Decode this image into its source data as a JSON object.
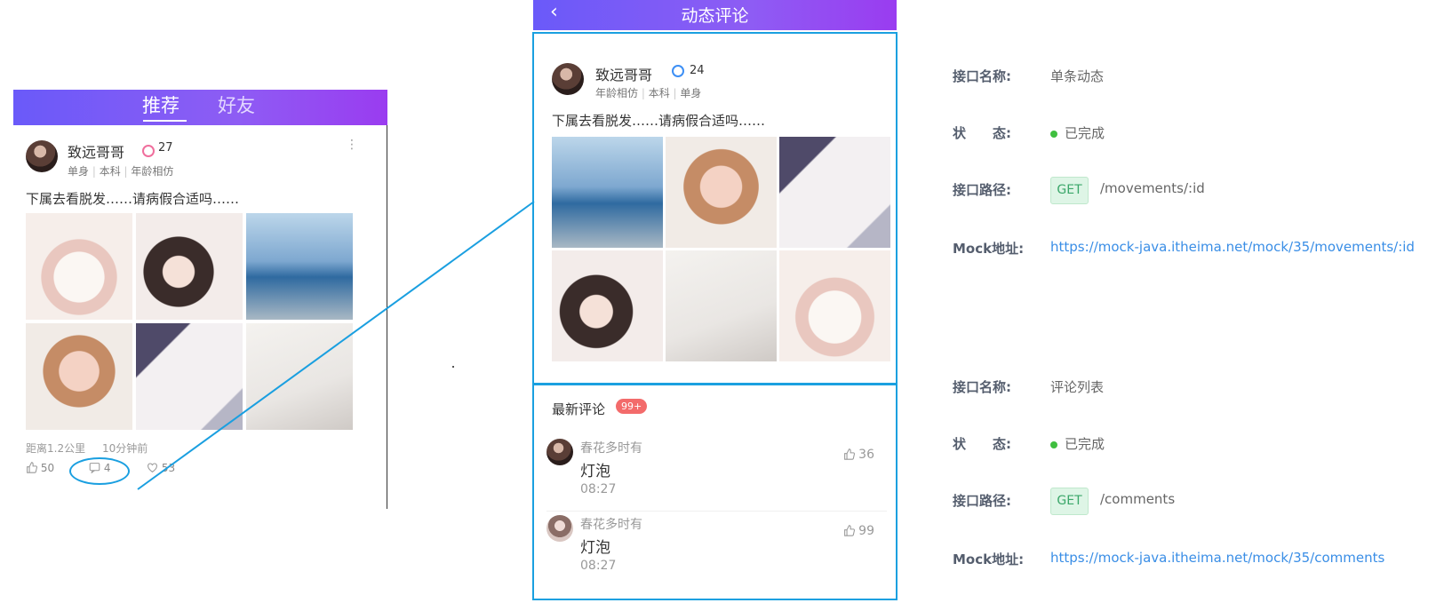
{
  "feed": {
    "tabs": [
      "推荐",
      "好友"
    ],
    "post": {
      "username": "致远哥哥",
      "age": "27",
      "tags": [
        "单身",
        "本科",
        "年龄相仿"
      ],
      "text": "下属去看脱发……请病假合适吗……",
      "distance": "距离1.2公里",
      "time": "10分钟前",
      "likes": "50",
      "comments": "4",
      "loves": "53",
      "more_icon": "⋮"
    }
  },
  "detail": {
    "title": "动态评论",
    "back_icon": "‹",
    "post": {
      "username": "致远哥哥",
      "age": "24",
      "tags": [
        "年龄相仿",
        "本科",
        "单身"
      ],
      "text": "下属去看脱发……请病假合适吗……"
    },
    "comments_header": "最新评论",
    "comments_badge": "99+",
    "comments": [
      {
        "user": "春花多时有",
        "content": "灯泡",
        "time": "08:27",
        "likes": "36"
      },
      {
        "user": "春花多时有",
        "content": "灯泡",
        "time": "08:27",
        "likes": "99"
      }
    ]
  },
  "api": [
    {
      "name_label": "接口名称:",
      "name": "单条动态",
      "status_label": "状　　态:",
      "status": "已完成",
      "path_label": "接口路径:",
      "method": "GET",
      "path": "/movements/:id",
      "mock_label": "Mock地址:",
      "mock_url": "https://mock-java.itheima.net/mock/35/movements/:id"
    },
    {
      "name_label": "接口名称:",
      "name": "评论列表",
      "status_label": "状　　态:",
      "status": "已完成",
      "path_label": "接口路径:",
      "method": "GET",
      "path": "/comments",
      "mock_label": "Mock地址:",
      "mock_url": "https://mock-java.itheima.net/mock/35/comments"
    }
  ],
  "colors": {
    "header_gradient_start": "#6a5af9",
    "header_gradient_end": "#9a3cf0",
    "highlight_border": "#1aa0e0",
    "status_green": "#3fbf3f",
    "link_blue": "#3a8ee6",
    "badge_red": "#f36b6b"
  }
}
